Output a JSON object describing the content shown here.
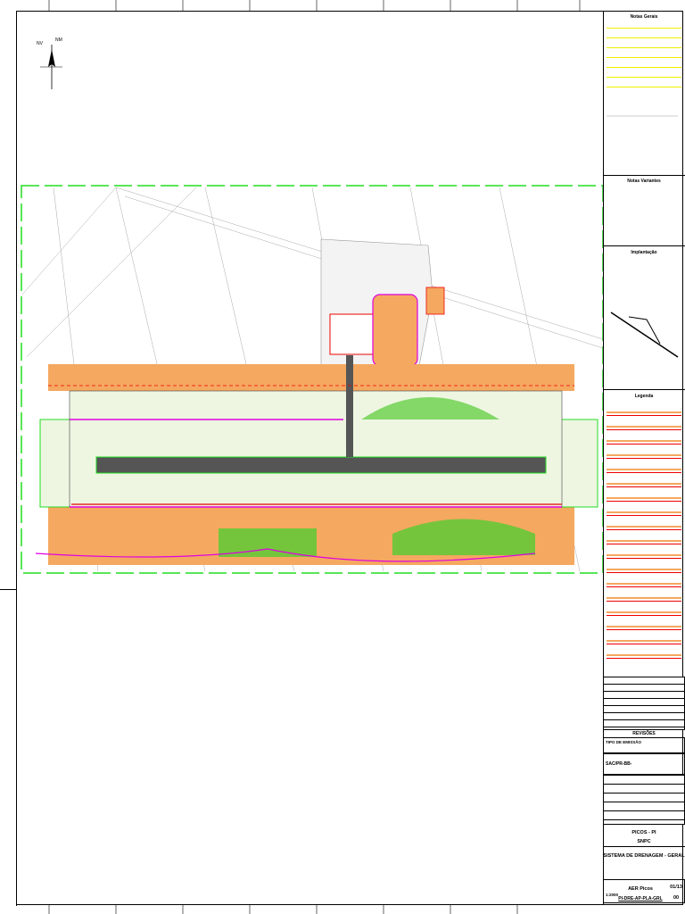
{
  "north_arrow": {
    "nv": "NV",
    "nm": "NM"
  },
  "panel": {
    "notes_title": "Notas Gerais",
    "variant_notes_title": "Notas Variantes",
    "location_title": "Implantação",
    "legend_title": "Legenda",
    "revisions_title": "REVISÕES",
    "emission_type": "TIPO DE EMISSÃO",
    "code": "SAC/PR-BB-",
    "city": "PICOS - PI",
    "airport_code": "SNPC",
    "drawing_title": "SISTEMA DE DRENAGEM - GERAL",
    "scale": "1:2000",
    "airport": "AER Picos",
    "drawing_number": "PI-DRE-AP-PLA-GRL",
    "sheet": "01/13",
    "revision": "00"
  },
  "colors": {
    "site_border": "#22dd22",
    "orange_fill": "#f5a860",
    "runway_fill": "#eef6e2",
    "runway": "#555555",
    "drainage": "#e000e0",
    "notes_text": "#e6e600",
    "red": "#ee0000"
  }
}
